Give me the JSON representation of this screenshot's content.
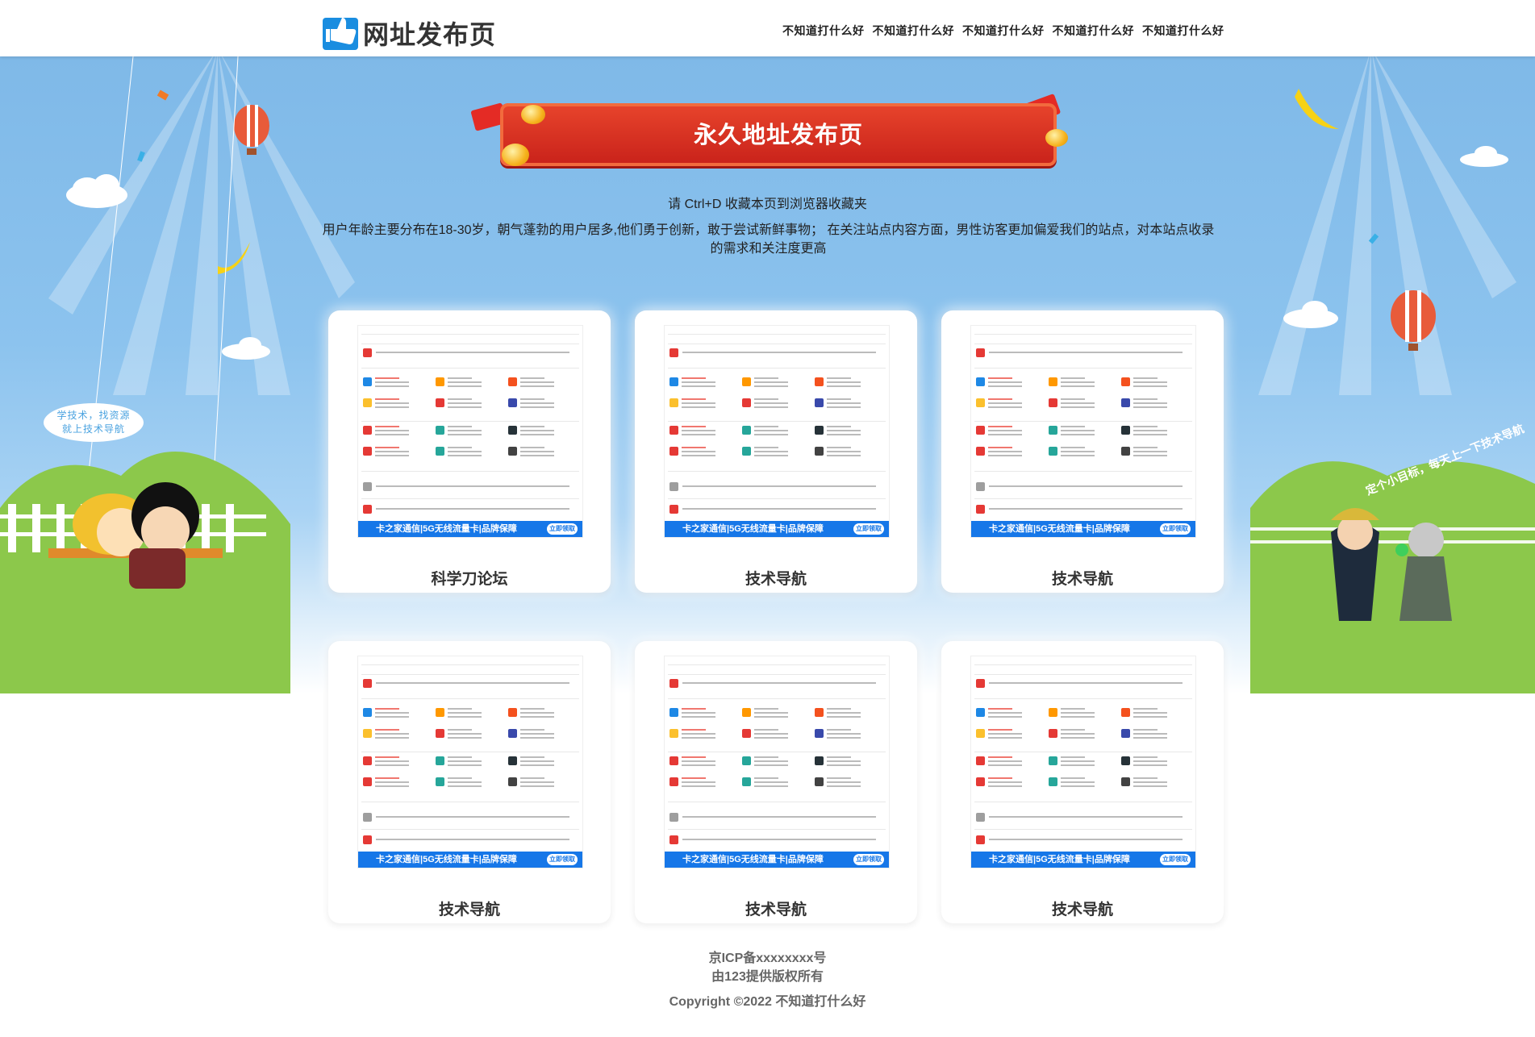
{
  "header": {
    "logo_text": "网址发布页",
    "nav": [
      "不知道打什么好",
      "不知道打什么好",
      "不知道打什么好",
      "不知道打什么好",
      "不知道打什么好"
    ]
  },
  "banner": {
    "title": "永久地址发布页"
  },
  "bookmark_hint": "请 Ctrl+D 收藏本页到浏览器收藏夹",
  "description": "用户年龄主要分布在18-30岁，朝气蓬勃的用户居多,他们勇于创新，敢于尝试新鲜事物； 在关注站点内容方面，男性访客更加偏爱我们的站点，对本站点收录的需求和关注度更高",
  "decor": {
    "speech_bubble": "学技术，找资源\n就上技术导航",
    "slogan": "定个小目标，每天上一下技术导航"
  },
  "cards": [
    {
      "title": "科学刀论坛",
      "ad_text": "卡之家通信|5G无线流量卡|品牌保障",
      "ad_button": "立即领取"
    },
    {
      "title": "技术导航",
      "ad_text": "卡之家通信|5G无线流量卡|品牌保障",
      "ad_button": "立即领取"
    },
    {
      "title": "技术导航",
      "ad_text": "卡之家通信|5G无线流量卡|品牌保障",
      "ad_button": "立即领取"
    },
    {
      "title": "技术导航",
      "ad_text": "卡之家通信|5G无线流量卡|品牌保障",
      "ad_button": "立即领取"
    },
    {
      "title": "技术导航",
      "ad_text": "卡之家通信|5G无线流量卡|品牌保障",
      "ad_button": "立即领取"
    },
    {
      "title": "技术导航",
      "ad_text": "卡之家通信|5G无线流量卡|品牌保障",
      "ad_button": "立即领取"
    }
  ],
  "footer": {
    "icp": "京ICP备xxxxxxxx号",
    "rights": "由123提供版权所有",
    "copyright": "Copyright ©2022 不知道打什么好"
  },
  "colors": {
    "banner_red": "#d22a1e",
    "sky_blue": "#7fb9e8",
    "ad_blue": "#1677e8"
  }
}
